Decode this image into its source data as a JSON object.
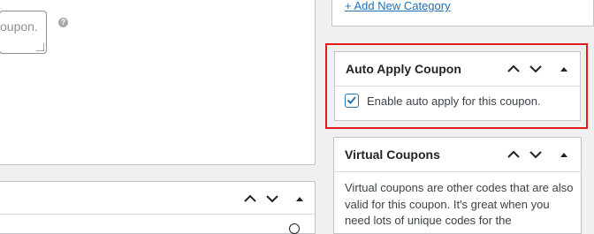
{
  "main": {
    "excerpt_text": "oupon.",
    "help_icon": "?"
  },
  "sidebar": {
    "category_link": "+ Add New Category",
    "auto_apply": {
      "title": "Auto Apply Coupon",
      "checkbox_label": "Enable auto apply for this coupon.",
      "checked": true
    },
    "virtual_coupons": {
      "title": "Virtual Coupons",
      "description": "Virtual coupons are other codes that are also valid for this coupon. It's great when you need lots of unique codes for the"
    }
  },
  "icons": {
    "move_up": "chevron-up-icon",
    "move_down": "chevron-down-icon",
    "toggle": "triangle-up-icon",
    "checkmark": "checkmark-icon"
  },
  "colors": {
    "link": "#2271b1",
    "highlight_frame": "#e21b1b",
    "checkbox_border": "#2271b1"
  }
}
